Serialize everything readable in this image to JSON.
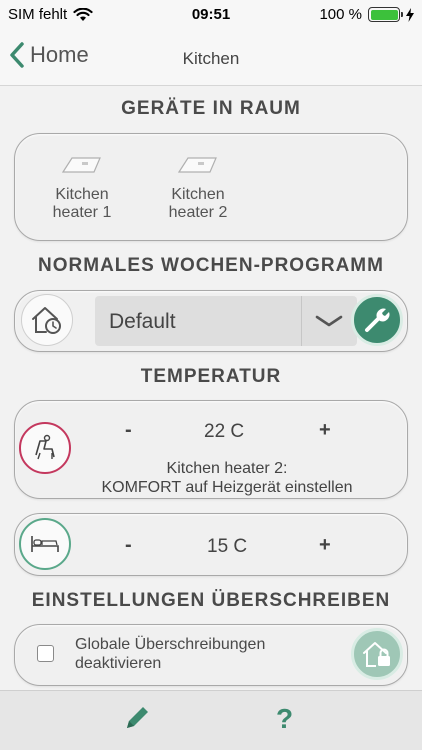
{
  "status_bar": {
    "carrier": "SIM fehlt",
    "time": "09:51",
    "battery": "100 %"
  },
  "nav": {
    "back_label": "Home",
    "title": "Kitchen"
  },
  "devices_section": {
    "title": "GERÄTE IN RAUM",
    "devices": [
      {
        "line1": "Kitchen",
        "line2": "heater 1"
      },
      {
        "line1": "Kitchen",
        "line2": "heater 2"
      }
    ]
  },
  "program_section": {
    "title": "NORMALES WOCHEN-PROGRAMM",
    "selected": "Default"
  },
  "temperature_section": {
    "title": "TEMPERATUR",
    "comfort": {
      "value": "22 C",
      "minus": "-",
      "plus": "+",
      "message_line1": "Kitchen heater 2:",
      "message_line2": "KOMFORT auf Heizgerät einstellen"
    },
    "eco": {
      "value": "15 C",
      "minus": "-",
      "plus": "+"
    }
  },
  "override_section": {
    "title": "EINSTELLUNGEN ÜBERSCHREIBEN",
    "checkbox_line1": "Globale Überschreibungen",
    "checkbox_line2": "deaktivieren",
    "checked": false
  },
  "bottom_bar": {
    "help": "?"
  },
  "colors": {
    "accent": "#3d8a6f",
    "comfort_ring": "#c4385e",
    "eco_ring": "#5aa88a",
    "battery": "#3cc13b"
  },
  "icons": [
    "wifi-icon",
    "charging-icon",
    "back-chevron-icon",
    "heater-icon",
    "house-clock-icon",
    "chevron-down-icon",
    "wrench-icon",
    "comfort-chair-icon",
    "bed-icon",
    "house-lock-icon",
    "pencil-icon",
    "help-icon"
  ]
}
